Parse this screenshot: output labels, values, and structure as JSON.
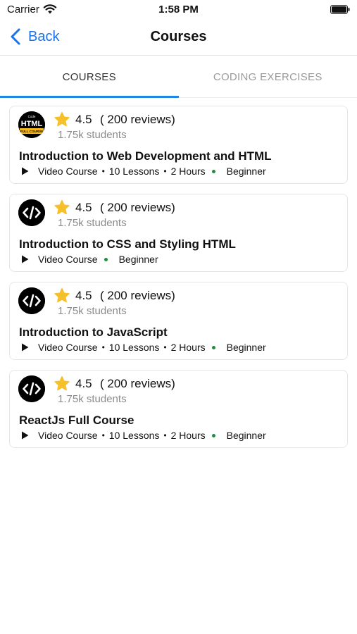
{
  "status_bar": {
    "carrier": "Carrier",
    "time": "1:58 PM"
  },
  "nav": {
    "back_label": "Back",
    "title": "Courses"
  },
  "tabs": [
    {
      "label": "COURSES",
      "active": true
    },
    {
      "label": "CODING EXERCISES",
      "active": false
    }
  ],
  "courses": [
    {
      "logo": "html-logo",
      "logo_text": {
        "top": "Code",
        "main": "HTML",
        "sub": "FULL COURSE"
      },
      "rating": "4.5",
      "reviews": "( 200 reviews)",
      "students": "1.75k students",
      "title": "Introduction to Web Development and HTML",
      "type": "Video Course",
      "lessons": "10 Lessons",
      "duration": "2 Hours",
      "level": "Beginner"
    },
    {
      "logo": "code-icon",
      "rating": "4.5",
      "reviews": "( 200 reviews)",
      "students": "1.75k students",
      "title": "Introduction to CSS and Styling HTML",
      "type": "Video Course",
      "level": "Beginner"
    },
    {
      "logo": "code-icon",
      "rating": "4.5",
      "reviews": "( 200 reviews)",
      "students": "1.75k students",
      "title": "Introduction to JavaScript",
      "type": "Video Course",
      "lessons": "10 Lessons",
      "duration": "2 Hours",
      "level": "Beginner"
    },
    {
      "logo": "code-icon",
      "rating": "4.5",
      "reviews": "( 200 reviews)",
      "students": "1.75k students",
      "title": "ReactJs Full Course",
      "type": "Video Course",
      "lessons": "10 Lessons",
      "duration": "2 Hours",
      "level": "Beginner"
    }
  ],
  "colors": {
    "accent": "#1a73e8",
    "tab_indicator": "#1e88e5",
    "star": "#f6c02b",
    "level_dot": "#1e8e3e"
  }
}
